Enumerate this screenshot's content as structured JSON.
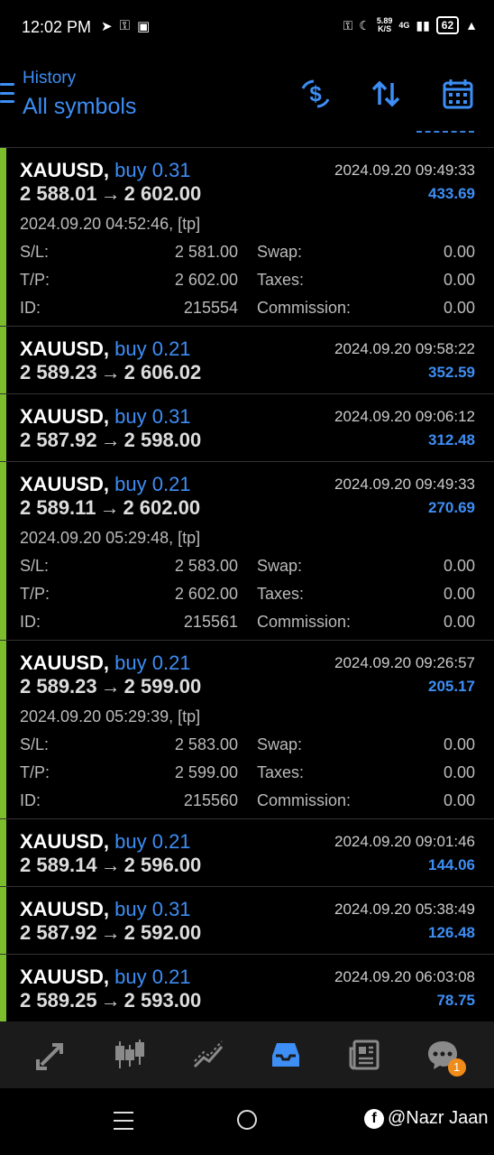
{
  "status_bar": {
    "time": "12:02 PM",
    "net_speed": "5.89",
    "net_unit": "K/S",
    "network": "4G",
    "battery": "62"
  },
  "header": {
    "subtitle": "History",
    "title": "All symbols"
  },
  "labels": {
    "sl": "S/L:",
    "tp": "T/P:",
    "id": "ID:",
    "swap": "Swap:",
    "taxes": "Taxes:",
    "commission": "Commission:",
    "arrow": "→"
  },
  "trades": [
    {
      "symbol": "XAUUSD,",
      "side": "buy 0.31",
      "open_price": "2 588.01",
      "close_price": "2 602.00",
      "close_time": "2024.09.20 09:49:33",
      "profit": "433.69",
      "expanded": true,
      "open_time": "2024.09.20 04:52:46, [tp]",
      "sl": "2 581.00",
      "tp": "2 602.00",
      "id": "215554",
      "swap": "0.00",
      "taxes": "0.00",
      "commission": "0.00"
    },
    {
      "symbol": "XAUUSD,",
      "side": "buy 0.21",
      "open_price": "2 589.23",
      "close_price": "2 606.02",
      "close_time": "2024.09.20 09:58:22",
      "profit": "352.59",
      "expanded": false
    },
    {
      "symbol": "XAUUSD,",
      "side": "buy 0.31",
      "open_price": "2 587.92",
      "close_price": "2 598.00",
      "close_time": "2024.09.20 09:06:12",
      "profit": "312.48",
      "expanded": false
    },
    {
      "symbol": "XAUUSD,",
      "side": "buy 0.21",
      "open_price": "2 589.11",
      "close_price": "2 602.00",
      "close_time": "2024.09.20 09:49:33",
      "profit": "270.69",
      "expanded": true,
      "open_time": "2024.09.20 05:29:48, [tp]",
      "sl": "2 583.00",
      "tp": "2 602.00",
      "id": "215561",
      "swap": "0.00",
      "taxes": "0.00",
      "commission": "0.00"
    },
    {
      "symbol": "XAUUSD,",
      "side": "buy 0.21",
      "open_price": "2 589.23",
      "close_price": "2 599.00",
      "close_time": "2024.09.20 09:26:57",
      "profit": "205.17",
      "expanded": true,
      "open_time": "2024.09.20 05:29:39, [tp]",
      "sl": "2 583.00",
      "tp": "2 599.00",
      "id": "215560",
      "swap": "0.00",
      "taxes": "0.00",
      "commission": "0.00"
    },
    {
      "symbol": "XAUUSD,",
      "side": "buy 0.21",
      "open_price": "2 589.14",
      "close_price": "2 596.00",
      "close_time": "2024.09.20 09:01:46",
      "profit": "144.06",
      "expanded": false
    },
    {
      "symbol": "XAUUSD,",
      "side": "buy 0.31",
      "open_price": "2 587.92",
      "close_price": "2 592.00",
      "close_time": "2024.09.20 05:38:49",
      "profit": "126.48",
      "expanded": false
    },
    {
      "symbol": "XAUUSD,",
      "side": "buy 0.21",
      "open_price": "2 589.25",
      "close_price": "2 593.00",
      "close_time": "2024.09.20 06:03:08",
      "profit": "78.75",
      "expanded": false
    }
  ],
  "bottom_nav": {
    "items": [
      {
        "icon": "quotes-icon",
        "active": false
      },
      {
        "icon": "chart-candles-icon",
        "active": false
      },
      {
        "icon": "trade-icon",
        "active": false
      },
      {
        "icon": "history-inbox-icon",
        "active": true
      },
      {
        "icon": "news-icon",
        "active": false
      },
      {
        "icon": "chat-icon",
        "active": false
      }
    ],
    "chat_badge": "1"
  },
  "watermark": "@Nazr Jaan",
  "colors": {
    "accent": "#3d8ef5",
    "buy_bar": "#7bbd2a",
    "badge": "#f08c1a"
  }
}
